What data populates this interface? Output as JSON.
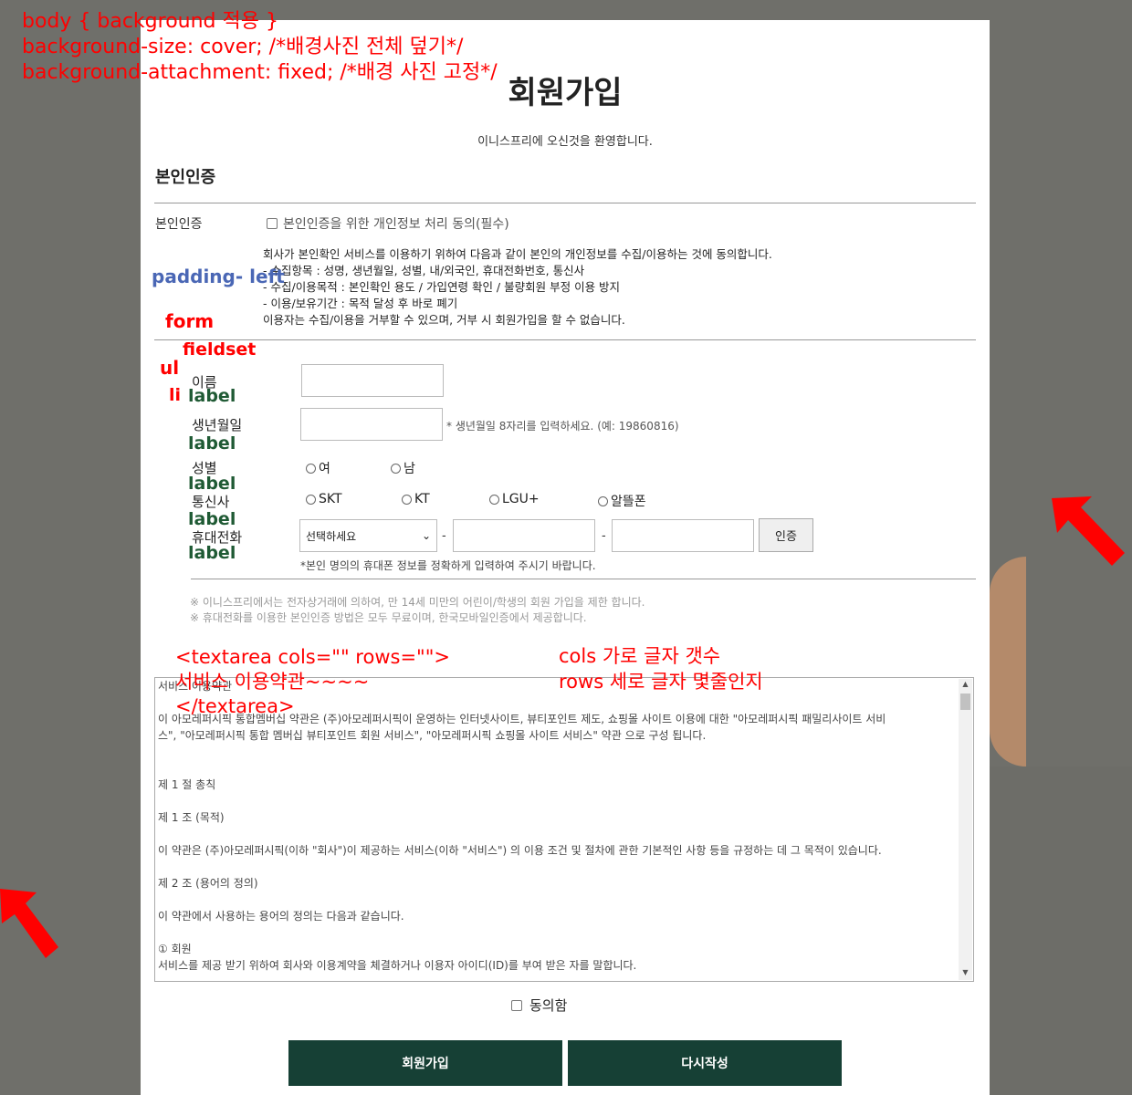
{
  "page": {
    "title": "회원가입",
    "welcome": "이니스프리에 오신것을 환영합니다.",
    "section_title": "본인인증"
  },
  "auth": {
    "label": "본인인증",
    "consent": "본인인증을 위한 개인정보 처리 동의(필수)",
    "notice": [
      "회사가 본인확인 서비스를 이용하기 위하여 다음과 같이 본인의 개인정보를 수집/이용하는 것에 동의합니다.",
      "- 수집항목 : 성명, 생년월일, 성별, 내/외국인, 휴대전화번호, 통신사",
      "- 수집/이용목적 : 본인확인 용도 / 가입연령 확인 / 불량회원 부정 이용 방지",
      "- 이용/보유기간 : 목적 달성 후 바로 폐기",
      "이용자는 수집/이용을 거부할 수 있으며, 거부 시 회원가입을 할 수 없습니다."
    ]
  },
  "form": {
    "name_label": "이름",
    "birth_label": "생년월일",
    "birth_hint": "* 생년월일 8자리를 입력하세요. (예: 19860816)",
    "gender_label": "성별",
    "gender_options": [
      "여",
      "남"
    ],
    "carrier_label": "통신사",
    "carrier_options": [
      "SKT",
      "KT",
      "LGU+",
      "알뜰폰"
    ],
    "phone_label": "휴대전화",
    "phone_select": "선택하세요",
    "phone_dash": "-",
    "cert_button": "인증",
    "phone_hint": "*본인 명의의 휴대폰 정보를 정확하게 입력하여 주시기 바랍니다.",
    "gray_notes": [
      "※ 이니스프리에서는 전자상거래에 의하여, 만 14세 미만의 어린이/학생의 회원 가입을 제한 합니다.",
      "※ 휴대전화를 이용한 본인인증 방법은 모두 무료이며, 한국모바일인증에서 제공합니다."
    ]
  },
  "terms": {
    "lines": [
      "서비스 이용약관",
      "",
      "이 아모레퍼시픽 통합멤버십 약관은 (주)아모레퍼시픽이 운영하는 인터넷사이트, 뷰티포인트 제도, 쇼핑몰 사이트 이용에 대한 \"아모레퍼시픽 패밀리사이트 서비",
      "스\", \"아모레퍼시픽 통합 멤버십 뷰티포인트 회원 서비스\", \"아모레퍼시픽 쇼핑몰 사이트 서비스\" 약관 으로 구성 됩니다.",
      "",
      "",
      "제 1 절 총칙",
      "",
      "제 1 조 (목적)",
      "",
      "이 약관은 (주)아모레퍼시픽(이하 \"회사\")이 제공하는 서비스(이하 \"서비스\") 의 이용 조건 및 절차에 관한 기본적인 사항 등을 규정하는 데 그 목적이 있습니다.",
      "",
      "제 2 조 (용어의 정의)",
      "",
      "이 약관에서 사용하는 용어의 정의는 다음과 같습니다.",
      "",
      "① 회원",
      "서비스를 제공 받기 위하여 회사와 이용계약을 체결하거나 이용자 아이디(ID)를 부여 받은 자를 말합니다."
    ],
    "agree": "동의함"
  },
  "buttons": {
    "join": "회원가입",
    "reset": "다시작성"
  },
  "annotations": {
    "css_lines": [
      "body { background 적용 }",
      "background-size: cover; /*배경사진 전체 덮기*/",
      "background-attachment: fixed; /*배경 사진 고정*/"
    ],
    "padding_left": "padding- left",
    "form": "form",
    "fieldset": "fieldset",
    "ul": "ul",
    "li": "li",
    "label": "label",
    "textarea_lines": [
      "<textarea cols=\"\" rows=\"\">",
      "서비스 이용약관~~~~",
      "</textarea>"
    ],
    "cols_rows": [
      "cols 가로 글자 갯수",
      "rows 세로 글자 몇줄인지"
    ]
  },
  "colors": {
    "background": "#6f6f6a",
    "button": "#164035",
    "annotation_red": "#ff0000",
    "annotation_green": "#1f5a34",
    "annotation_blue": "#4a67b5"
  }
}
